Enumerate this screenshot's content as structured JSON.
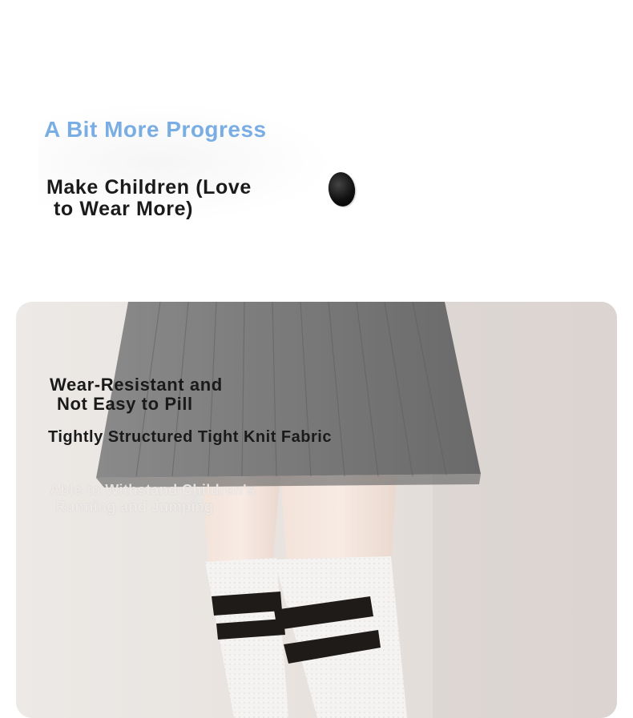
{
  "intro": {
    "subtitle": "A Bit More Progress",
    "headline_line1": "Make Children (Love",
    "headline_line2": "to Wear More)"
  },
  "feature": {
    "title_line1": "Wear-Resistant and",
    "title_line2": "Not Easy to Pill",
    "description": "Tightly Structured Tight Knit Fabric",
    "note_line1": "Able to Withstand Children's",
    "note_line2": "Running and Jumping"
  },
  "colors": {
    "accent": "#79ade4",
    "headline": "#1b1b1b",
    "skirt": "#7b7b7c",
    "sock_stripe": "#1f1b19",
    "background": "#ffffff"
  }
}
